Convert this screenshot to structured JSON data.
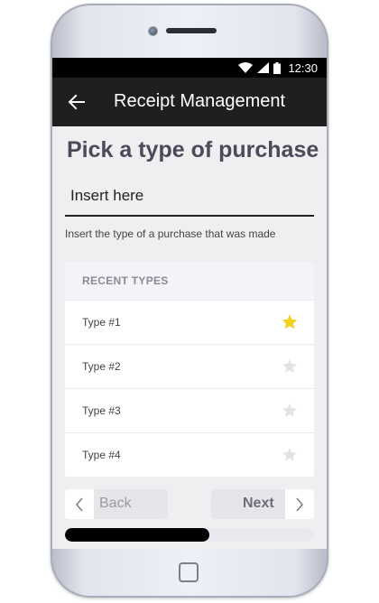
{
  "status_bar": {
    "time": "12:30",
    "icons": [
      "wifi-icon",
      "signal-icon",
      "battery-icon"
    ]
  },
  "app_bar": {
    "title": "Receipt Management",
    "back_icon": "arrow-left-icon"
  },
  "page": {
    "title": "Pick a type of purchase",
    "input": {
      "placeholder": "Insert here",
      "value": ""
    },
    "helper_text": "Insert the type of a purchase that was made"
  },
  "recent": {
    "header": "RECENT TYPES",
    "items": [
      {
        "label": "Type #1",
        "starred": true
      },
      {
        "label": "Type #2",
        "starred": false
      },
      {
        "label": "Type #3",
        "starred": false
      },
      {
        "label": "Type #4",
        "starred": false
      }
    ]
  },
  "navigation": {
    "back_label": "Back",
    "next_label": "Next"
  },
  "progress": {
    "fraction": 0.58
  },
  "colors": {
    "star_active": "#f5d21e",
    "star_inactive": "#e2e2e8",
    "app_bar": "#1f1f1f",
    "title_text": "#4a4a5a"
  }
}
